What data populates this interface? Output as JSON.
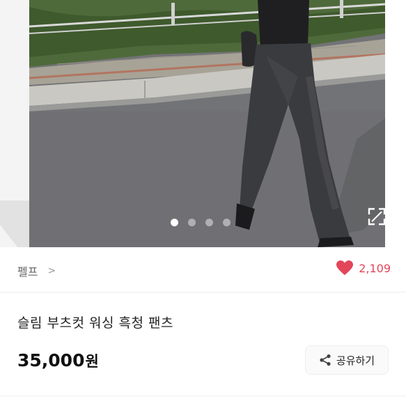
{
  "product": {
    "image_count": 5,
    "active_image_index": 0,
    "seller_name": "펠프",
    "likes": "2,109",
    "title": "슬림 부츠컷 워싱 흑청 팬츠",
    "price": "35,000",
    "price_unit": "원",
    "share_label": "공유하기"
  },
  "icons": {
    "seller_chevron": "chevron-right-icon",
    "like": "heart-icon",
    "share": "share-icon",
    "expand": "fullscreen-icon"
  },
  "colors": {
    "like": "#e3455a",
    "text": "#222222",
    "muted": "#666666"
  }
}
